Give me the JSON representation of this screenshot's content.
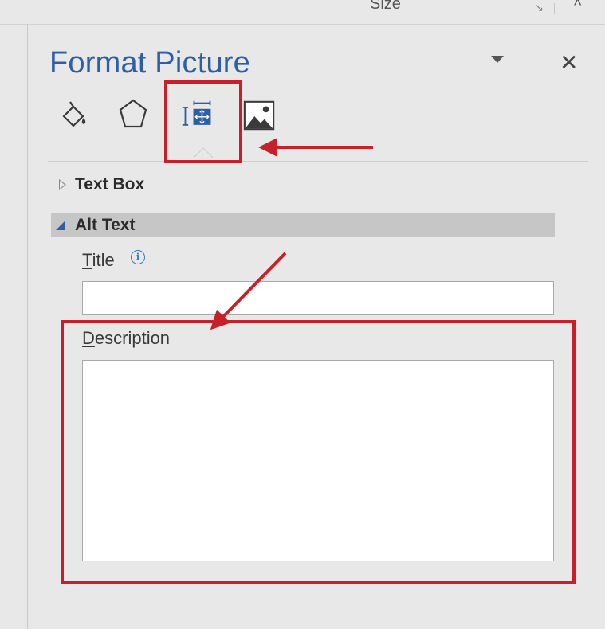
{
  "ribbon": {
    "size_label": "Size",
    "launcher_glyph": "↘",
    "collapse_glyph": "^"
  },
  "pane": {
    "title": "Format Picture",
    "dropdown_icon": "chevron-down-icon",
    "close_glyph": "✕"
  },
  "tabs": [
    {
      "name": "Fill & Line",
      "icon": "paint-bucket-icon"
    },
    {
      "name": "Effects",
      "icon": "pentagon-icon"
    },
    {
      "name": "Layout & Properties",
      "icon": "layout-properties-icon",
      "selected": true
    },
    {
      "name": "Picture",
      "icon": "picture-icon"
    }
  ],
  "sections": {
    "text_box": {
      "label": "Text Box",
      "expanded": false
    },
    "alt_text": {
      "label": "Alt Text",
      "expanded": true,
      "title_label_first": "T",
      "title_label_rest": "itle",
      "title_value": "",
      "info_glyph": "i",
      "description_label_first": "D",
      "description_label_rest": "escription",
      "description_value": ""
    }
  },
  "colors": {
    "accent": "#2e5ea6",
    "annotation_red": "#c8202a",
    "section_header_bg": "#c6c6c6",
    "background": "#e9e8e8"
  }
}
